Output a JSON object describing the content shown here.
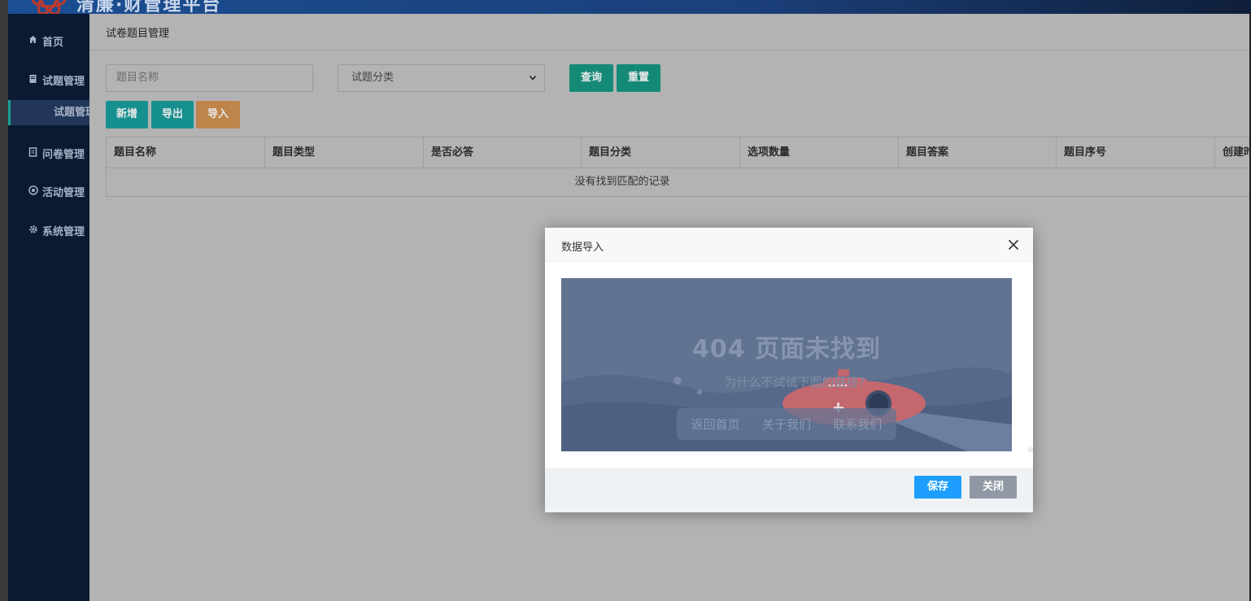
{
  "brand": {
    "title": "清廉·财管理平台"
  },
  "sidebar": {
    "items": [
      {
        "label": "首页",
        "icon": "home-icon"
      },
      {
        "label": "试题管理",
        "icon": "book-icon"
      },
      {
        "label": "问卷管理",
        "icon": "file-icon"
      },
      {
        "label": "活动管理",
        "icon": "soccer-ball-icon"
      },
      {
        "label": "系统管理",
        "icon": "gear-icon"
      }
    ],
    "sub_item": {
      "label": "试题管理"
    }
  },
  "page": {
    "title": "试卷题目管理"
  },
  "filters": {
    "name_placeholder": "题目名称",
    "category_selected": "试题分类"
  },
  "toolbar": {
    "query_label": "查询",
    "reset_label": "重置",
    "add_label": "新增",
    "export_label": "导出",
    "import_label": "导入"
  },
  "table": {
    "columns": [
      "题目名称",
      "题目类型",
      "是否必答",
      "题目分类",
      "选项数量",
      "题目答案",
      "题目序号",
      "创建时间"
    ],
    "empty_text": "没有找到匹配的记录"
  },
  "modal": {
    "title": "数据导入",
    "not_found": {
      "heading": "404 页面未找到",
      "subtitle": "为什么不试试下面的链接?",
      "links": [
        "返回首页",
        "关于我们",
        "联系我们"
      ]
    },
    "save_label": "保存",
    "close_label": "关闭"
  },
  "colors": {
    "sidebar_bg": "#0a1a33",
    "overlay_bg": "#b3b3b3",
    "btn_green": "#148a76",
    "btn_teal": "#168f8f",
    "btn_orange": "#bf844a",
    "save_blue": "#1e9fff",
    "close_gray": "#8f98a3",
    "frame_bg": "#617390"
  }
}
